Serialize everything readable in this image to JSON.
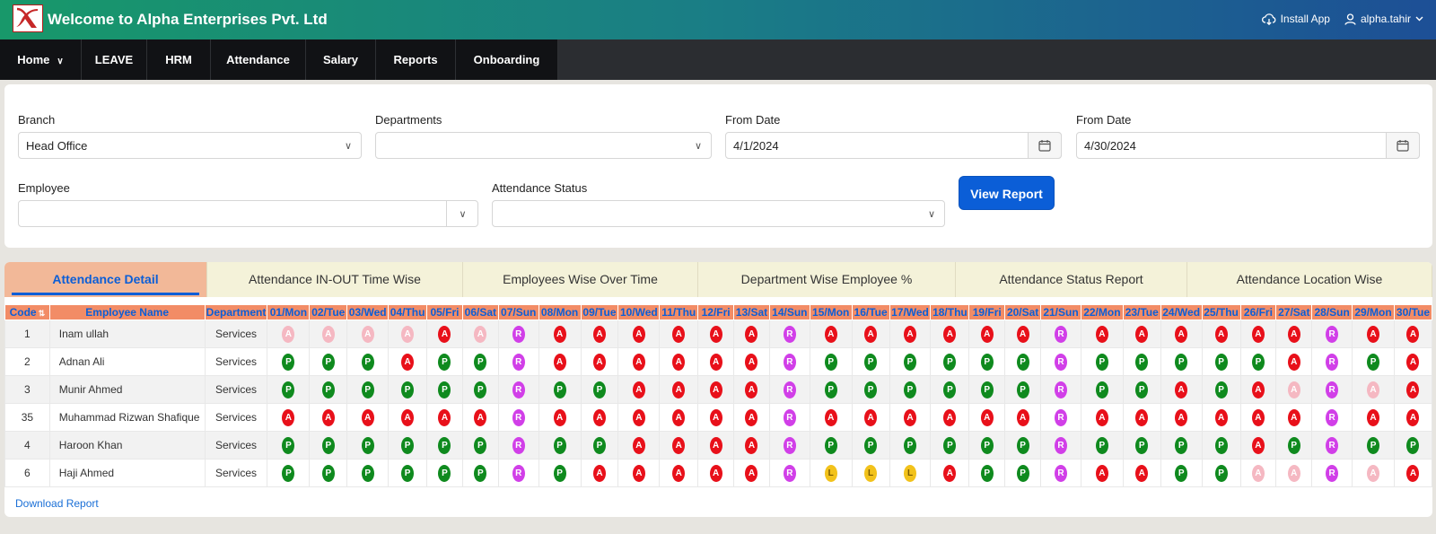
{
  "app": {
    "title": "Welcome to Alpha Enterprises Pvt. Ltd",
    "install_label": "Install App",
    "user_label": "alpha.tahir"
  },
  "nav": {
    "items": [
      {
        "label": "Home",
        "dropdown": true
      },
      {
        "label": "LEAVE"
      },
      {
        "label": "HRM"
      },
      {
        "label": "Attendance"
      },
      {
        "label": "Salary"
      },
      {
        "label": "Reports"
      },
      {
        "label": "Onboarding"
      }
    ]
  },
  "filters": {
    "branch_label": "Branch",
    "branch_value": "Head Office",
    "departments_label": "Departments",
    "departments_value": "",
    "from_date_label": "From Date",
    "from_date_value": "4/1/2024",
    "to_date_label": "From Date",
    "to_date_value": "4/30/2024",
    "employee_label": "Employee",
    "employee_value": "",
    "status_label": "Attendance Status",
    "status_value": "",
    "view_button": "View Report"
  },
  "tabs": [
    {
      "label": "Attendance Detail",
      "active": true
    },
    {
      "label": "Attendance IN-OUT Time Wise"
    },
    {
      "label": "Employees Wise Over Time"
    },
    {
      "label": "Department Wise Employee %"
    },
    {
      "label": "Attendance Status Report"
    },
    {
      "label": "Attendance Location Wise"
    }
  ],
  "table": {
    "headers": {
      "code": "Code",
      "name": "Employee Name",
      "department": "Department"
    },
    "days": [
      "01/Mon",
      "02/Tue",
      "03/Wed",
      "04/Thu",
      "05/Fri",
      "06/Sat",
      "07/Sun",
      "08/Mon",
      "09/Tue",
      "10/Wed",
      "11/Thu",
      "12/Fri",
      "13/Sat",
      "14/Sun",
      "15/Mon",
      "16/Tue",
      "17/Wed",
      "18/Thu",
      "19/Fri",
      "20/Sat",
      "21/Sun",
      "22/Mon",
      "23/Tue",
      "24/Wed",
      "25/Thu",
      "26/Fri",
      "27/Sat",
      "28/Sun",
      "29/Mon",
      "30/Tue"
    ],
    "status_colors": {
      "P": "#0f8a1e",
      "A": "#e8101a",
      "a": "#f5b8c2",
      "R": "#d13fe8",
      "L": "#f2c21b"
    },
    "rows": [
      {
        "code": "1",
        "name": "Inam ullah",
        "department": "Services",
        "statuses": [
          "a",
          "a",
          "a",
          "a",
          "A",
          "a",
          "R",
          "A",
          "A",
          "A",
          "A",
          "A",
          "A",
          "R",
          "A",
          "A",
          "A",
          "A",
          "A",
          "A",
          "R",
          "A",
          "A",
          "A",
          "A",
          "A",
          "A",
          "R",
          "A",
          "A"
        ]
      },
      {
        "code": "2",
        "name": "Adnan Ali",
        "department": "Services",
        "statuses": [
          "P",
          "P",
          "P",
          "A",
          "P",
          "P",
          "R",
          "A",
          "A",
          "A",
          "A",
          "A",
          "A",
          "R",
          "P",
          "P",
          "P",
          "P",
          "P",
          "P",
          "R",
          "P",
          "P",
          "P",
          "P",
          "P",
          "A",
          "R",
          "P",
          "A"
        ]
      },
      {
        "code": "3",
        "name": "Munir Ahmed",
        "department": "Services",
        "statuses": [
          "P",
          "P",
          "P",
          "P",
          "P",
          "P",
          "R",
          "P",
          "P",
          "A",
          "A",
          "A",
          "A",
          "R",
          "P",
          "P",
          "P",
          "P",
          "P",
          "P",
          "R",
          "P",
          "P",
          "A",
          "P",
          "A",
          "a",
          "R",
          "a",
          "A"
        ]
      },
      {
        "code": "35",
        "name": "Muhammad Rizwan Shafique",
        "department": "Services",
        "statuses": [
          "A",
          "A",
          "A",
          "A",
          "A",
          "A",
          "R",
          "A",
          "A",
          "A",
          "A",
          "A",
          "A",
          "R",
          "A",
          "A",
          "A",
          "A",
          "A",
          "A",
          "R",
          "A",
          "A",
          "A",
          "A",
          "A",
          "A",
          "R",
          "A",
          "A"
        ]
      },
      {
        "code": "4",
        "name": "Haroon Khan",
        "department": "Services",
        "statuses": [
          "P",
          "P",
          "P",
          "P",
          "P",
          "P",
          "R",
          "P",
          "P",
          "A",
          "A",
          "A",
          "A",
          "R",
          "P",
          "P",
          "P",
          "P",
          "P",
          "P",
          "R",
          "P",
          "P",
          "P",
          "P",
          "A",
          "P",
          "R",
          "P",
          "P"
        ]
      },
      {
        "code": "6",
        "name": "Haji Ahmed",
        "department": "Services",
        "statuses": [
          "P",
          "P",
          "P",
          "P",
          "P",
          "P",
          "R",
          "P",
          "A",
          "A",
          "A",
          "A",
          "A",
          "R",
          "L",
          "L",
          "L",
          "A",
          "P",
          "P",
          "R",
          "A",
          "A",
          "P",
          "P",
          "a",
          "a",
          "R",
          "a",
          "A"
        ]
      }
    ]
  },
  "download_label": "Download Report"
}
